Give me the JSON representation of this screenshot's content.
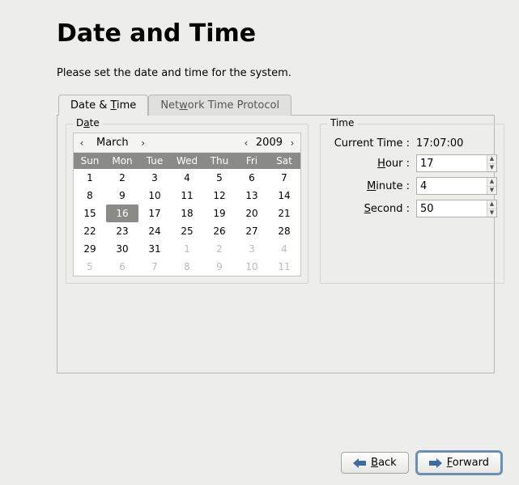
{
  "title": "Date and Time",
  "instruction": "Please set the date and time for the system.",
  "tabs": {
    "date_time_pre": "Date & ",
    "date_time_u": "T",
    "date_time_post": "ime",
    "ntp_pre": "Net",
    "ntp_u": "w",
    "ntp_post": "ork Time Protocol"
  },
  "date_group_pre": "D",
  "date_group_u": "a",
  "date_group_post": "te",
  "time_group": "Time",
  "calendar": {
    "month": "March",
    "year": "2009",
    "daynames": [
      "Sun",
      "Mon",
      "Tue",
      "Wed",
      "Thu",
      "Fri",
      "Sat"
    ],
    "cells": [
      {
        "n": "1"
      },
      {
        "n": "2"
      },
      {
        "n": "3"
      },
      {
        "n": "4"
      },
      {
        "n": "5"
      },
      {
        "n": "6"
      },
      {
        "n": "7"
      },
      {
        "n": "8"
      },
      {
        "n": "9"
      },
      {
        "n": "10"
      },
      {
        "n": "11"
      },
      {
        "n": "12"
      },
      {
        "n": "13"
      },
      {
        "n": "14"
      },
      {
        "n": "15"
      },
      {
        "n": "16",
        "sel": true
      },
      {
        "n": "17"
      },
      {
        "n": "18"
      },
      {
        "n": "19"
      },
      {
        "n": "20"
      },
      {
        "n": "21"
      },
      {
        "n": "22"
      },
      {
        "n": "23"
      },
      {
        "n": "24"
      },
      {
        "n": "25"
      },
      {
        "n": "26"
      },
      {
        "n": "27"
      },
      {
        "n": "28"
      },
      {
        "n": "29"
      },
      {
        "n": "30"
      },
      {
        "n": "31"
      },
      {
        "n": "1",
        "dim": true
      },
      {
        "n": "2",
        "dim": true
      },
      {
        "n": "3",
        "dim": true
      },
      {
        "n": "4",
        "dim": true
      },
      {
        "n": "5",
        "dim": true
      },
      {
        "n": "6",
        "dim": true
      },
      {
        "n": "7",
        "dim": true
      },
      {
        "n": "8",
        "dim": true
      },
      {
        "n": "9",
        "dim": true
      },
      {
        "n": "10",
        "dim": true
      },
      {
        "n": "11",
        "dim": true
      }
    ]
  },
  "time": {
    "current_label": "Current Time :",
    "current_value": "17:07:00",
    "hour_u": "H",
    "hour_post": "our :",
    "minute_u": "M",
    "minute_post": "inute :",
    "second_u": "S",
    "second_post": "econd :",
    "hour": "17",
    "minute": "4",
    "second": "50"
  },
  "buttons": {
    "back_u": "B",
    "back_post": "ack",
    "forward_u": "F",
    "forward_post": "orward"
  }
}
